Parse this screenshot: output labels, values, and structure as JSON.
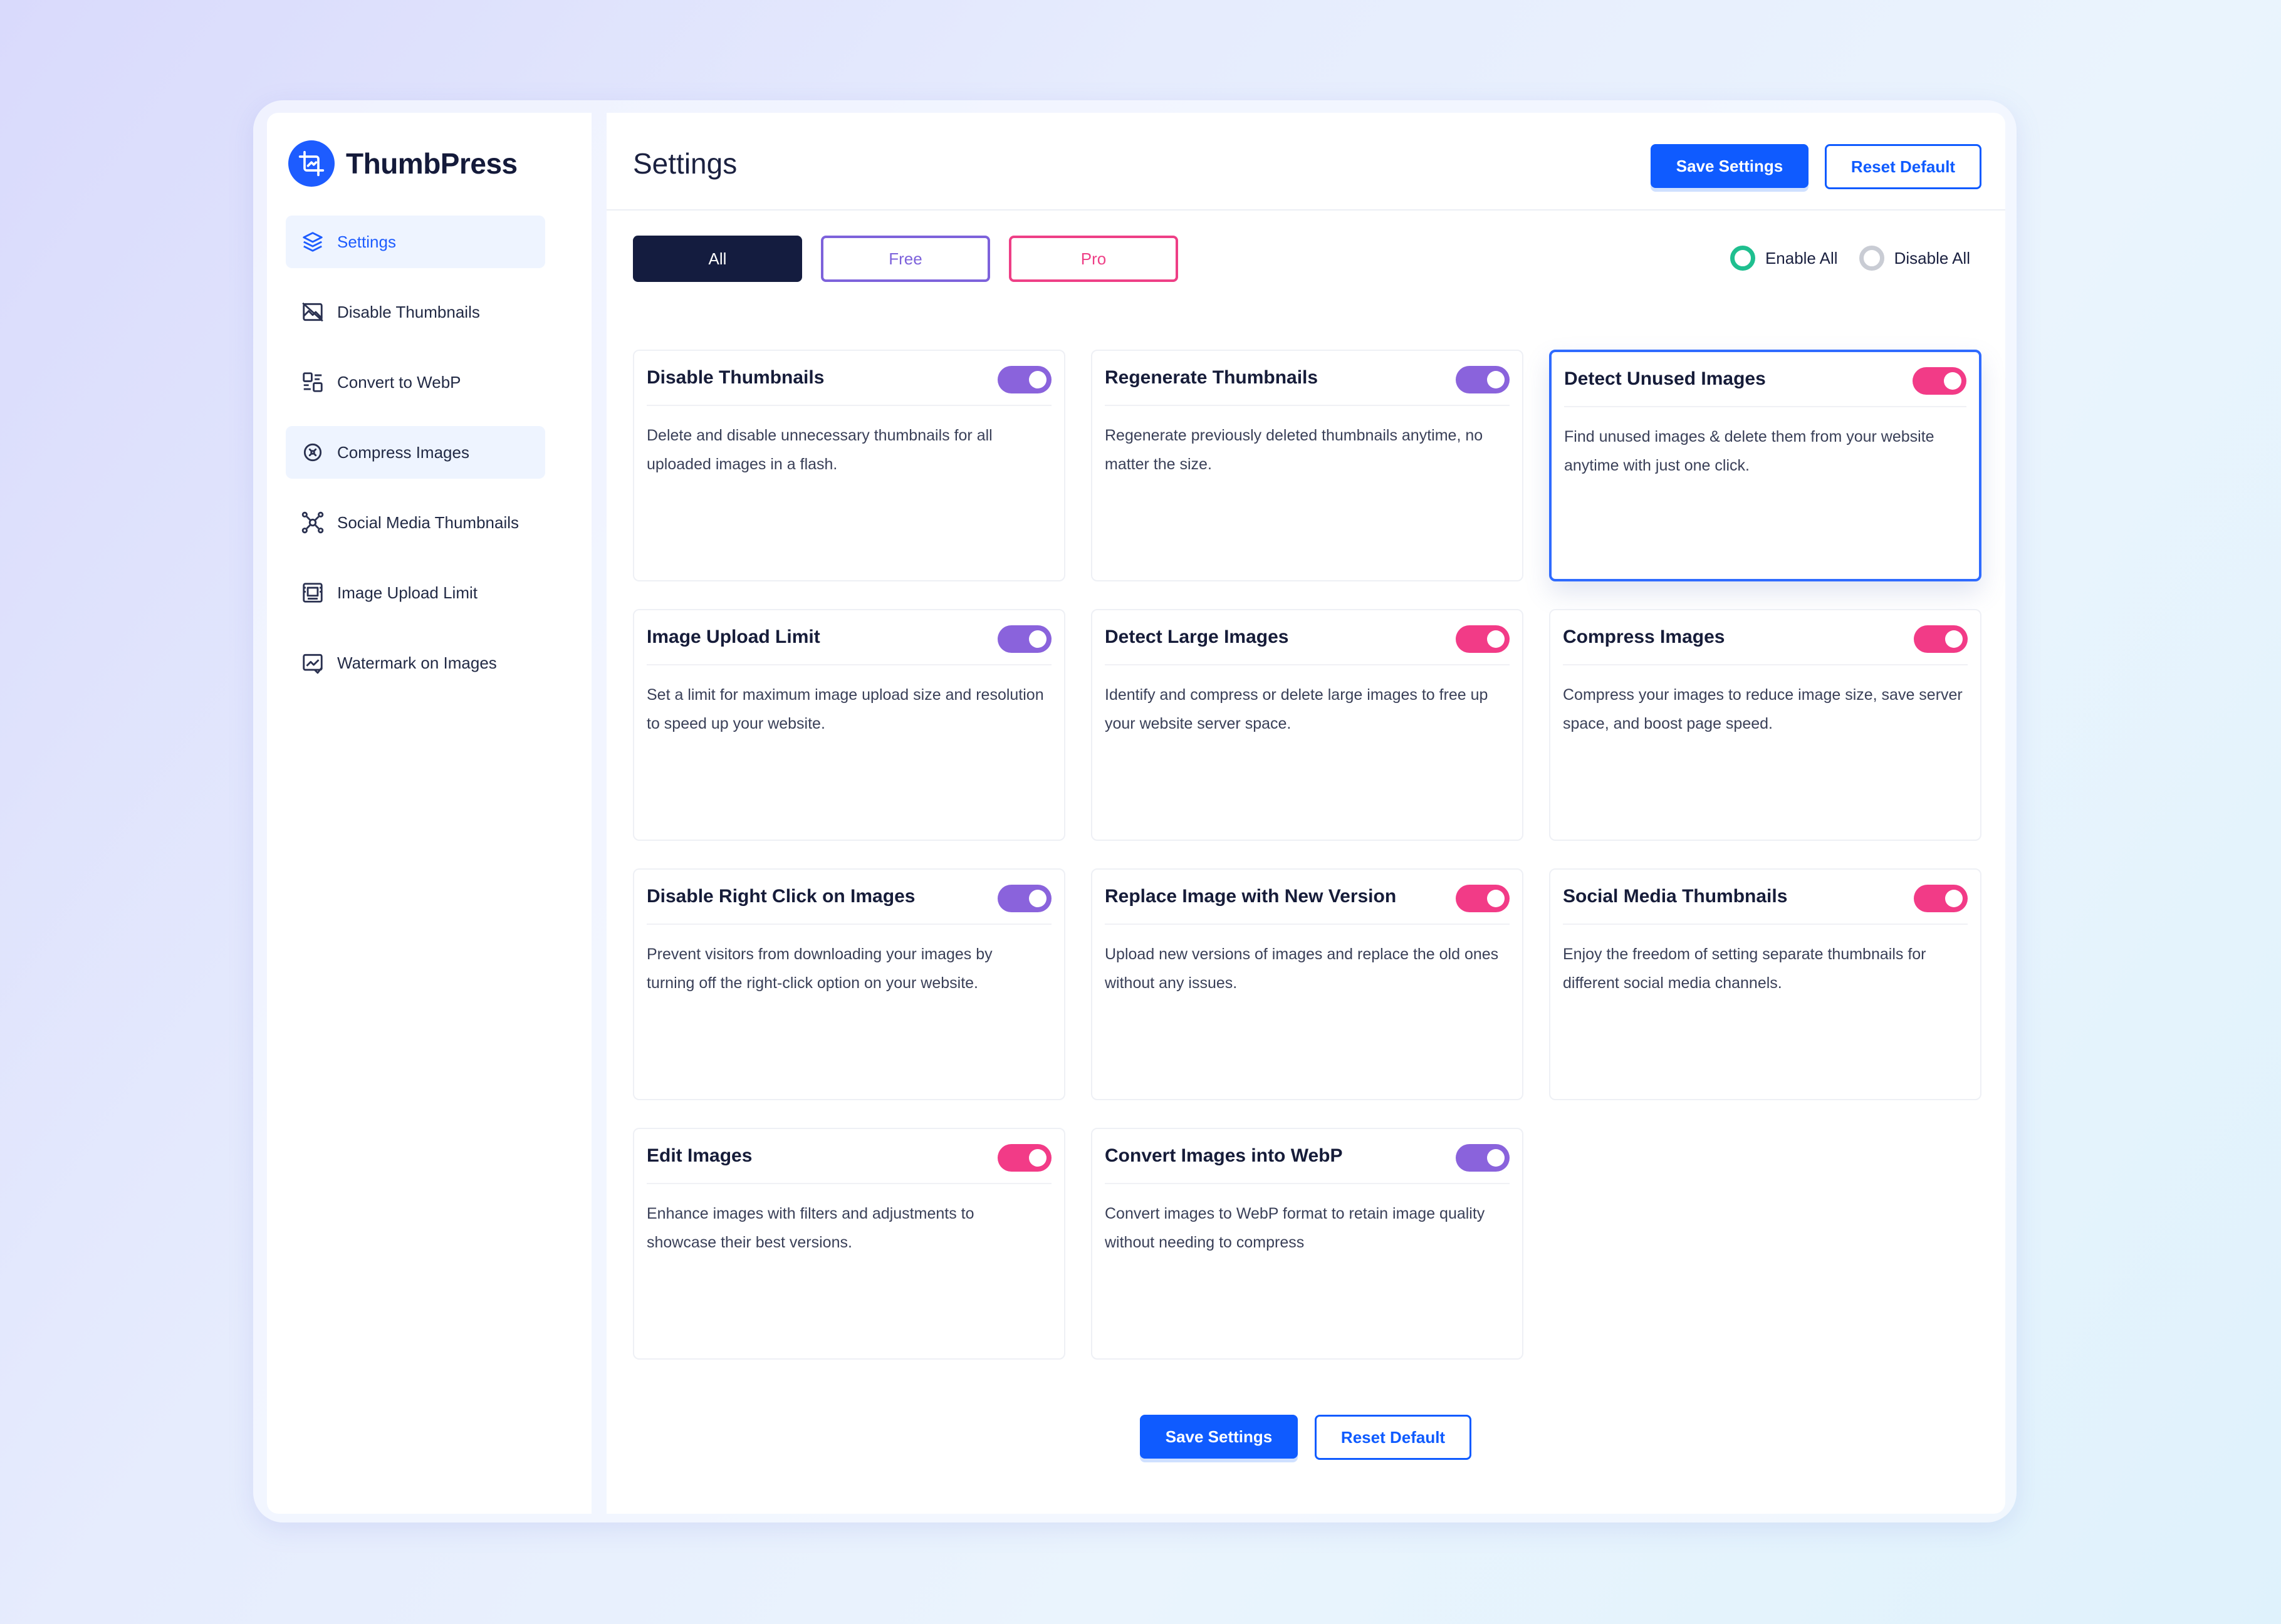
{
  "brand": {
    "name": "ThumbPress"
  },
  "sidebar": {
    "items": [
      {
        "label": "Settings",
        "icon": "layers-icon"
      },
      {
        "label": "Disable Thumbnails",
        "icon": "image-off-icon"
      },
      {
        "label": "Convert to WebP",
        "icon": "convert-icon"
      },
      {
        "label": "Compress Images",
        "icon": "compress-icon"
      },
      {
        "label": "Social Media Thumbnails",
        "icon": "share-network-icon"
      },
      {
        "label": "Image Upload Limit",
        "icon": "upload-limit-icon"
      },
      {
        "label": "Watermark on Images",
        "icon": "watermark-icon"
      }
    ]
  },
  "header": {
    "title": "Settings",
    "save_label": "Save Settings",
    "reset_label": "Reset Default"
  },
  "filters": {
    "all": "All",
    "free": "Free",
    "pro": "Pro"
  },
  "bulk": {
    "enable_all": "Enable All",
    "disable_all": "Disable All"
  },
  "colors": {
    "accent": "#0f5bff",
    "free": "#8a63dc",
    "pro": "#f23b87",
    "enabled_radio": "#1fbf8f"
  },
  "modules": [
    {
      "title": "Disable Thumbnails",
      "desc": "Delete and disable unnecessary thumbnails for all uploaded images in a flash.",
      "tier": "free"
    },
    {
      "title": "Regenerate Thumbnails",
      "desc": "Regenerate previously deleted thumbnails anytime, no matter the size.",
      "tier": "free"
    },
    {
      "title": "Detect Unused Images",
      "desc": "Find unused images & delete them from your website anytime with just one click.",
      "tier": "pro"
    },
    {
      "title": "Image Upload Limit",
      "desc": "Set a limit for maximum image upload size and resolution to speed up your website.",
      "tier": "free"
    },
    {
      "title": "Detect Large Images",
      "desc": "Identify and compress or delete large images to free up your website server space.",
      "tier": "pro"
    },
    {
      "title": "Compress Images",
      "desc": "Compress your images to reduce image size, save server space, and boost page speed.",
      "tier": "pro"
    },
    {
      "title": "Disable Right Click on Images",
      "desc": "Prevent visitors from downloading your images by turning off the right-click option on your website.",
      "tier": "free"
    },
    {
      "title": "Replace Image with New Version",
      "desc": "Upload new versions of images and replace the old ones without any issues.",
      "tier": "pro"
    },
    {
      "title": "Social Media Thumbnails",
      "desc": "Enjoy the freedom of setting separate thumbnails for different social media channels.",
      "tier": "pro"
    },
    {
      "title": "Edit Images",
      "desc": "Enhance images with filters and adjustments to showcase their best versions.",
      "tier": "pro"
    },
    {
      "title": "Convert Images into WebP",
      "desc": "Convert images to WebP format to retain image quality without needing to compress",
      "tier": "free"
    }
  ],
  "footer": {
    "save_label": "Save Settings",
    "reset_label": "Reset Default"
  }
}
